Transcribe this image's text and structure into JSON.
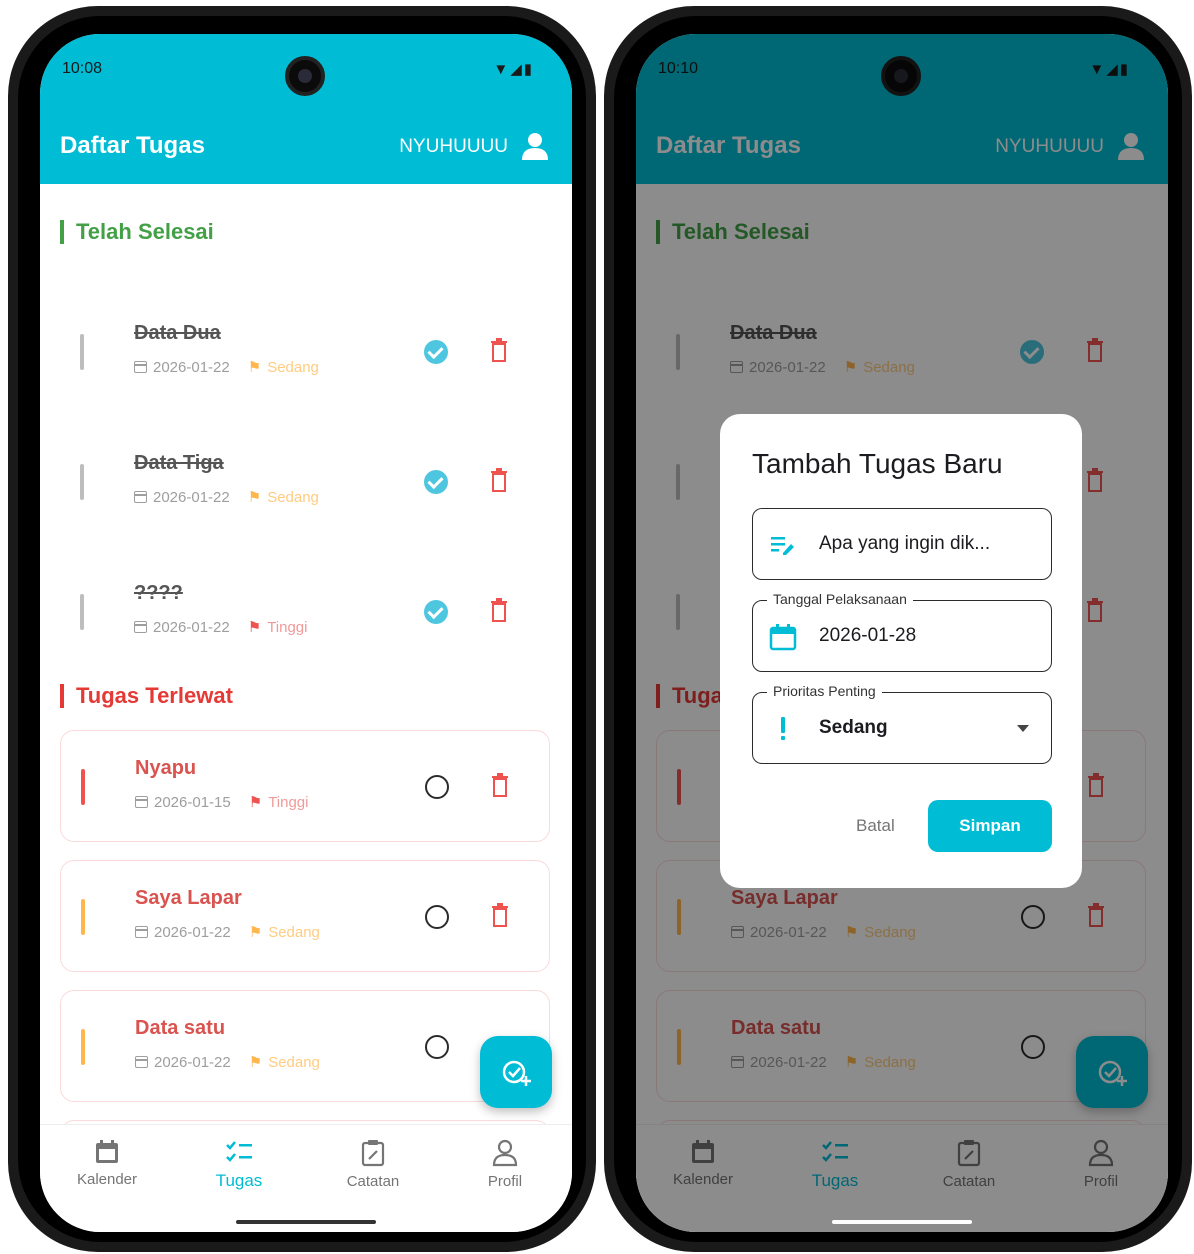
{
  "status": {
    "time_left": "10:08",
    "time_right": "10:10",
    "icons": "▼◢▮"
  },
  "appbar": {
    "title": "Daftar Tugas",
    "user": "NYUHUUUU"
  },
  "sections": {
    "done": "Telah Selesai",
    "late": "Tugas Terlewat"
  },
  "done_tasks": [
    {
      "title": "Data Dua",
      "date": "2026-01-22",
      "priority": "Sedang"
    },
    {
      "title": "Data Tiga",
      "date": "2026-01-22",
      "priority": "Sedang"
    },
    {
      "title": "????",
      "date": "2026-01-22",
      "priority": "Tinggi"
    }
  ],
  "late_tasks": [
    {
      "title": "Nyapu",
      "date": "2026-01-15",
      "priority": "Tinggi"
    },
    {
      "title": "Saya Lapar",
      "date": "2026-01-22",
      "priority": "Sedang"
    },
    {
      "title": "Data satu",
      "date": "2026-01-22",
      "priority": "Sedang"
    }
  ],
  "nav": [
    "Kalender",
    "Tugas",
    "Catatan",
    "Profil"
  ],
  "dialog": {
    "title": "Tambah Tugas Baru",
    "task_placeholder": "Apa yang ingin dik...",
    "date_label": "Tanggal Pelaksanaan",
    "date_value": "2026-01-28",
    "priority_label": "Prioritas Penting",
    "priority_value": "Sedang",
    "cancel": "Batal",
    "save": "Simpan"
  },
  "colors": {
    "primary": "#00bcd4",
    "done": "#43a047",
    "late": "#e53935",
    "sedang": "#ffb74d",
    "tinggi": "#ef5350"
  }
}
